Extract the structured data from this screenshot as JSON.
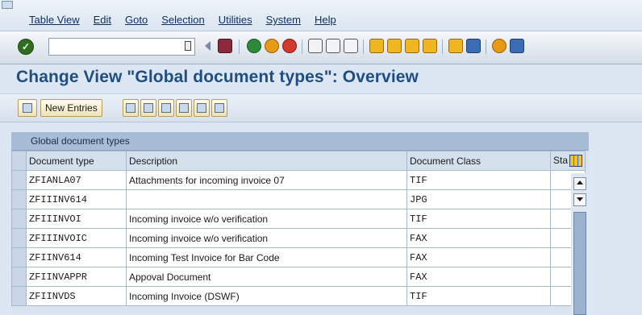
{
  "menu": {
    "items": [
      "Table View",
      "Edit",
      "Goto",
      "Selection",
      "Utilities",
      "System",
      "Help"
    ]
  },
  "toolbar": {
    "ok_icon": "check-icon",
    "command_field_value": ""
  },
  "page": {
    "title": "Change View \"Global document types\": Overview"
  },
  "app_toolbar": {
    "new_entries_label": "New Entries"
  },
  "table": {
    "panel_title": "Global document types",
    "columns": {
      "doc_type": "Document type",
      "description": "Description",
      "doc_class": "Document Class",
      "status": "Sta"
    },
    "rows": [
      {
        "doc_type": "ZFIANLA07",
        "description": "Attachments for incoming invoice 07",
        "doc_class": "TIF"
      },
      {
        "doc_type": "ZFIIINV614",
        "description": "",
        "doc_class": "JPG"
      },
      {
        "doc_type": "ZFIIINVOI",
        "description": "Incoming invoice w/o verification",
        "doc_class": "TIF"
      },
      {
        "doc_type": "ZFIIINVOIC",
        "description": "Incoming invoice w/o verification",
        "doc_class": "FAX"
      },
      {
        "doc_type": "ZFIINV614",
        "description": "Incoming Test Invoice for Bar Code",
        "doc_class": "FAX"
      },
      {
        "doc_type": "ZFIINVAPPR",
        "description": "Appoval Document",
        "doc_class": "FAX"
      },
      {
        "doc_type": "ZFIINVDS",
        "description": "Incoming Invoice (DSWF)",
        "doc_class": "TIF"
      }
    ]
  }
}
